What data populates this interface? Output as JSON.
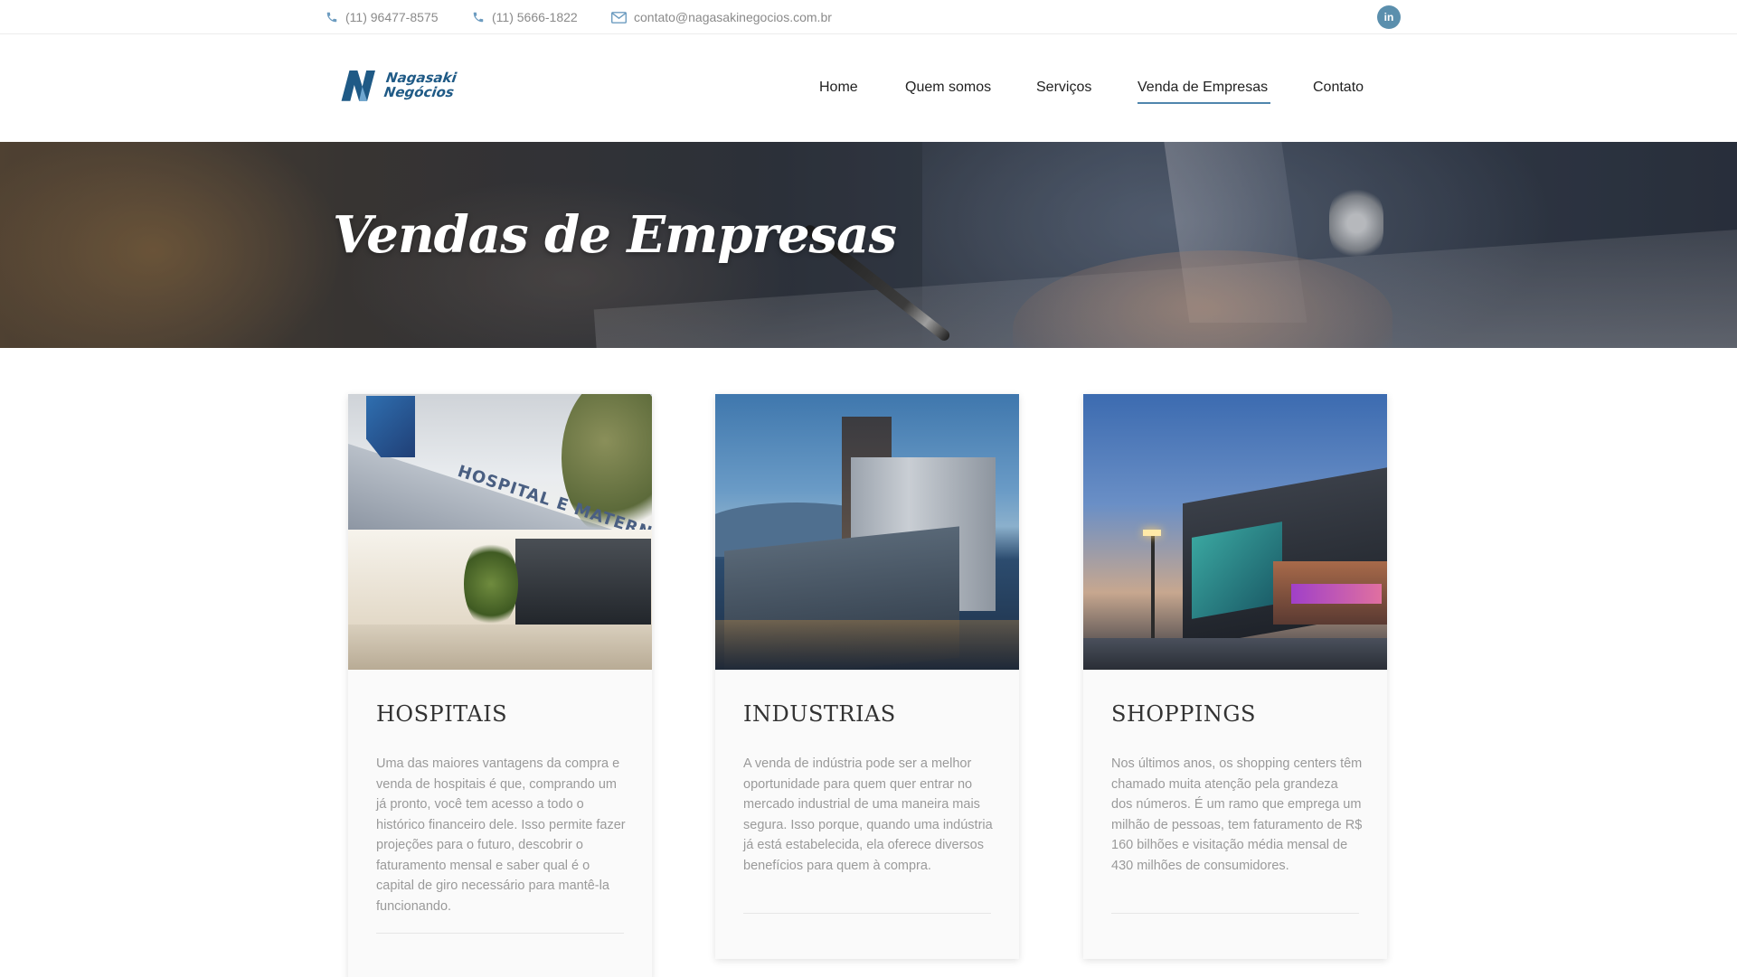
{
  "topbar": {
    "phone1": "(11) 96477-8575",
    "phone2": "(11) 5666-1822",
    "email": "contato@nagasakinegocios.com.br",
    "social_icon": "linkedin-icon",
    "social_label": "in"
  },
  "header": {
    "logo_line1": "Nagasaki",
    "logo_line2": "Negócios",
    "nav": [
      {
        "label": "Home"
      },
      {
        "label": "Quem somos"
      },
      {
        "label": "Serviços"
      },
      {
        "label": "Venda de Empresas",
        "active": true
      },
      {
        "label": "Contato"
      }
    ]
  },
  "hero": {
    "title": "Vendas de Empresas"
  },
  "cards": [
    {
      "title": "HOSPITAIS",
      "photo_sign": "HOSPITAL E MATERNIDADE",
      "text": "Uma das maiores vantagens da compra e venda de hospitais é que, comprando um já pronto, você tem acesso a todo o histórico financeiro dele. Isso permite fazer projeções para o futuro, descobrir o faturamento mensal e saber qual é o capital de giro necessário para mantê-la funcionando."
    },
    {
      "title": "INDUSTRIAS",
      "text": "A venda de indústria pode ser a melhor oportunidade para quem quer entrar no mercado industrial de uma maneira mais segura. Isso porque, quando uma indústria já está estabelecida, ela oferece diversos benefícios para quem à compra."
    },
    {
      "title": "SHOPPINGS",
      "text": "Nos últimos anos, os shopping centers têm chamado muita atenção pela grandeza dos números. É um ramo que emprega um milhão de pessoas, tem faturamento de R$ 160 bilhões e visitação média mensal de 430 milhões de consumidores."
    }
  ],
  "colors": {
    "accent": "#4f86ad",
    "icon": "#6d9cc0",
    "logo": "#1f5a86"
  }
}
